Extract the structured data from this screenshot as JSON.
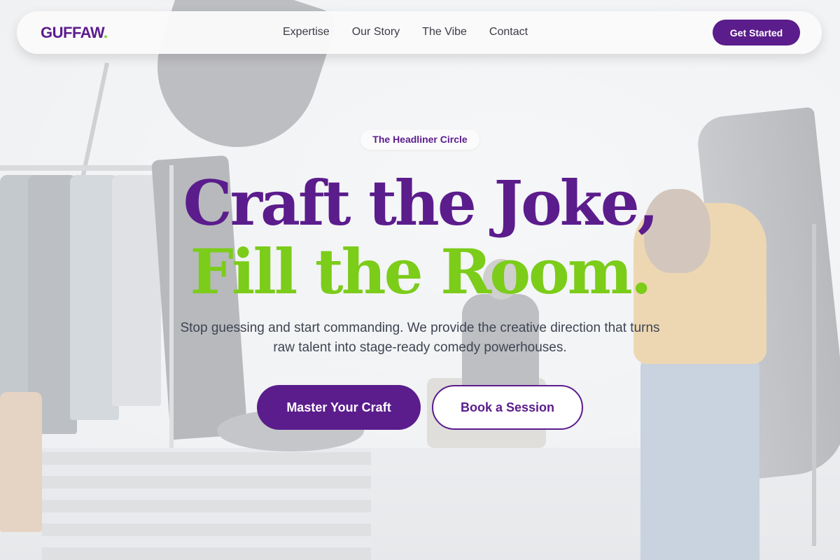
{
  "nav": {
    "logo_text": "GUFFAW",
    "logo_dot": ".",
    "links": [
      "Expertise",
      "Our Story",
      "The Vibe",
      "Contact"
    ],
    "cta_label": "Get Started"
  },
  "hero": {
    "badge": "The Headliner Circle",
    "headline_line1": "Craft the Joke,",
    "headline_line2": "Fill the Room.",
    "subtitle": "Stop guessing and start commanding. We provide the creative direction that turns raw talent into stage-ready comedy powerhouses.",
    "primary_button": "Master Your Craft",
    "secondary_button": "Book a Session"
  },
  "colors": {
    "brand_purple": "#5b1c8c",
    "accent_green": "#7ccc1a",
    "nav_background": "#fafafb",
    "body_text": "#3f4452"
  }
}
